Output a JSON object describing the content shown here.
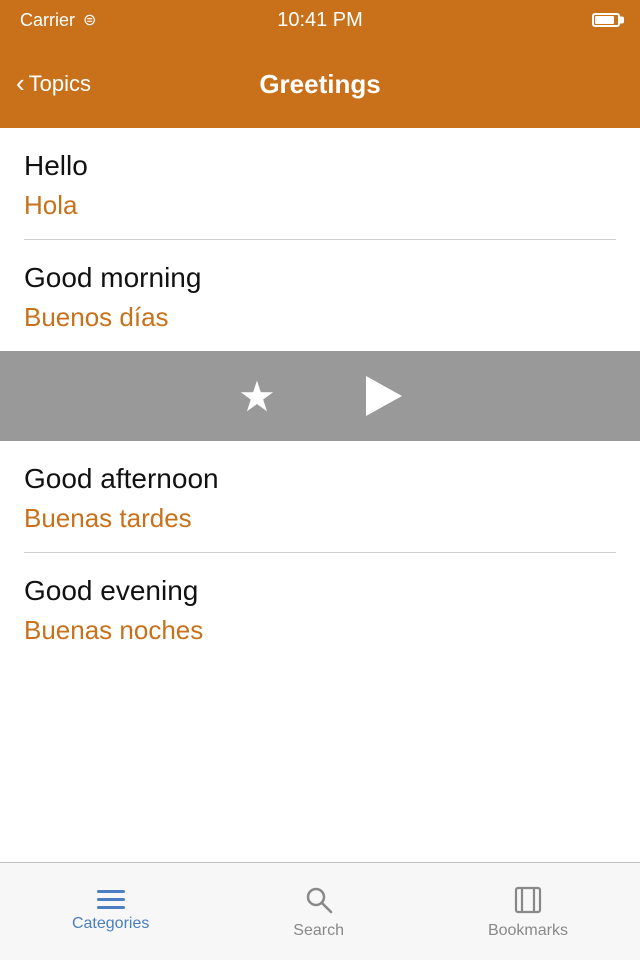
{
  "statusBar": {
    "carrier": "Carrier",
    "time": "10:41 PM"
  },
  "navBar": {
    "backLabel": "Topics",
    "title": "Greetings"
  },
  "phrases": [
    {
      "english": "Hello",
      "spanish": "Hola"
    },
    {
      "english": "Good morning",
      "spanish": "Buenos días"
    },
    {
      "english": "Good afternoon",
      "spanish": "Buenas tardes"
    },
    {
      "english": "Good evening",
      "spanish": "Buenas noches"
    }
  ],
  "actionBar": {
    "starLabel": "★",
    "playLabel": "▶"
  },
  "tabBar": {
    "tabs": [
      {
        "id": "categories",
        "label": "Categories",
        "active": true
      },
      {
        "id": "search",
        "label": "Search",
        "active": false
      },
      {
        "id": "bookmarks",
        "label": "Bookmarks",
        "active": false
      }
    ]
  },
  "colors": {
    "accent": "#c8711a",
    "activeTab": "#4a7fc1"
  }
}
